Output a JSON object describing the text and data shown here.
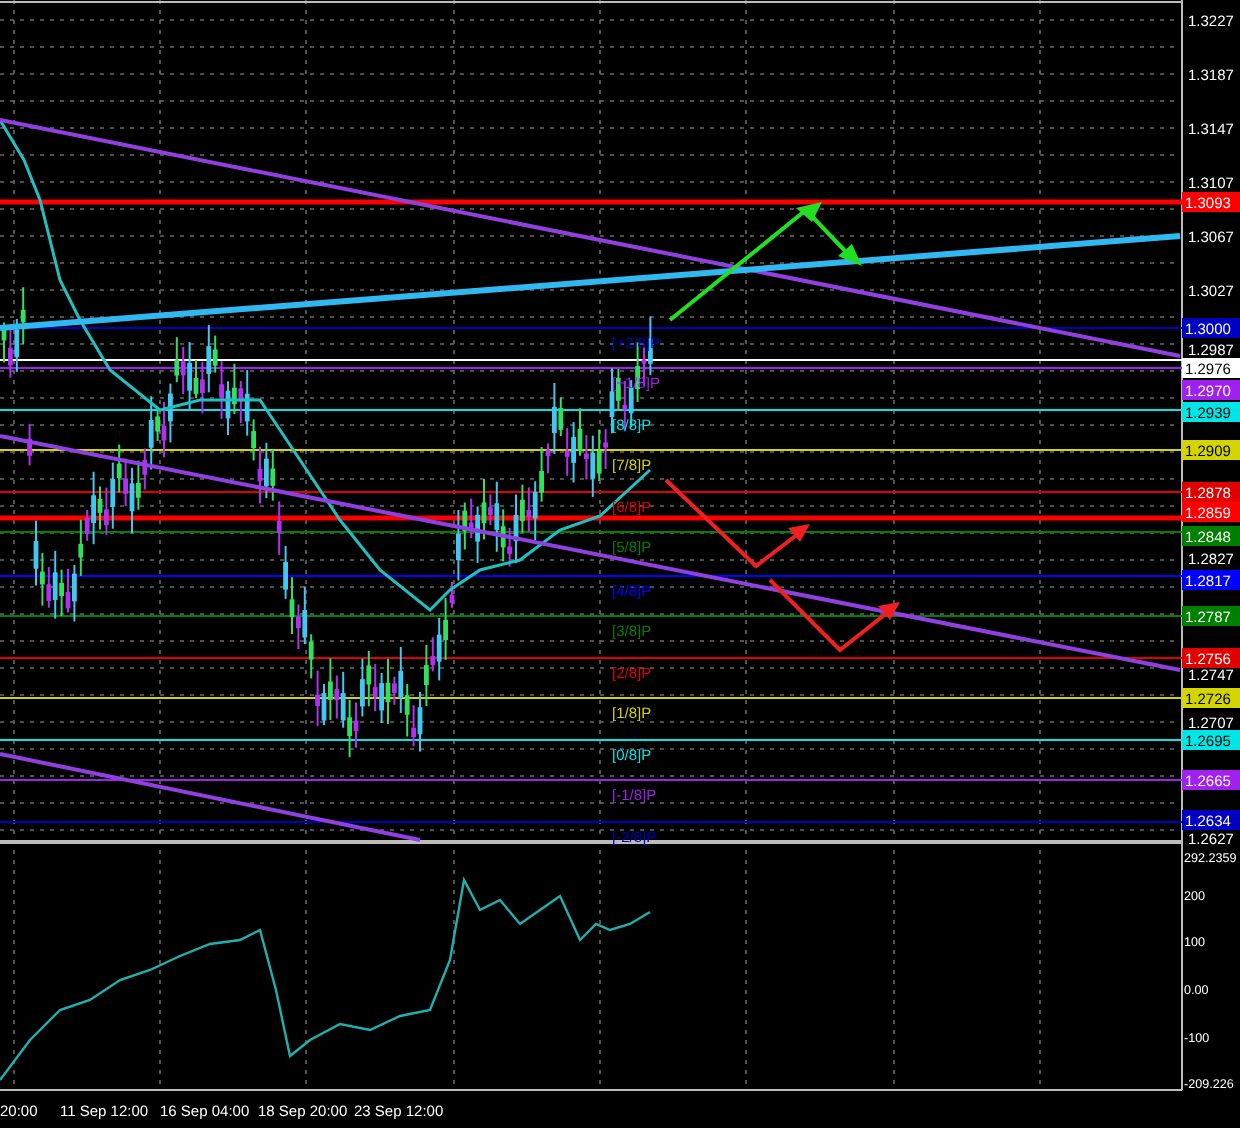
{
  "chart": {
    "price_axis": {
      "ticks": [
        "1.3227",
        "1.3187",
        "1.3147",
        "1.3107",
        "1.3067",
        "1.3027",
        "1.2987",
        "1.2827",
        "1.2747",
        "1.2707",
        "1.2627"
      ]
    },
    "levels": [
      {
        "kind": "line",
        "price": "1.3093",
        "color": "#ff0000"
      },
      {
        "kind": "murrey",
        "label": "[+2/8]P",
        "price": "1.3000",
        "color": "#0000c0"
      },
      {
        "kind": "bid",
        "price": "1.2976",
        "color": "#ffffff"
      },
      {
        "kind": "murrey",
        "label": "[+1/8]P",
        "price": "1.2970",
        "color": "#a020f0"
      },
      {
        "kind": "murrey",
        "label": "[8/8]P",
        "price": "1.2939",
        "color": "#00e5e5"
      },
      {
        "kind": "murrey",
        "label": "[7/8]P",
        "price": "1.2909",
        "color": "#d4d400"
      },
      {
        "kind": "murrey",
        "label": "[6/8]P",
        "price": "1.2878",
        "color": "#e00000"
      },
      {
        "kind": "line",
        "price": "1.2859",
        "color": "#ff0000"
      },
      {
        "kind": "murrey",
        "label": "[5/8]P",
        "price": "1.2848",
        "color": "#008000"
      },
      {
        "kind": "murrey",
        "label": "[4/8]P",
        "price": "1.2817",
        "color": "#0000ff"
      },
      {
        "kind": "murrey",
        "label": "[3/8]P",
        "price": "1.2787",
        "color": "#008000"
      },
      {
        "kind": "murrey",
        "label": "[2/8]P",
        "price": "1.2756",
        "color": "#e00000"
      },
      {
        "kind": "murrey",
        "label": "[1/8]P",
        "price": "1.2726",
        "color": "#d4d400"
      },
      {
        "kind": "murrey",
        "label": "[0/8]P",
        "price": "1.2695",
        "color": "#00e5e5"
      },
      {
        "kind": "murrey",
        "label": "[-1/8]P",
        "price": "1.2665",
        "color": "#a020f0"
      },
      {
        "kind": "murrey",
        "label": "[-2/8]P",
        "price": "1.2634",
        "color": "#0000c0"
      }
    ],
    "oscillator_axis": {
      "ticks": [
        "292.2359",
        "200",
        "100",
        "0.00",
        "-100",
        "-209.226"
      ]
    },
    "time_axis": {
      "labels": [
        "20:00",
        "11 Sep 12:00",
        "16 Sep 04:00",
        "18 Sep 20:00",
        "23 Sep 12:00"
      ]
    }
  }
}
